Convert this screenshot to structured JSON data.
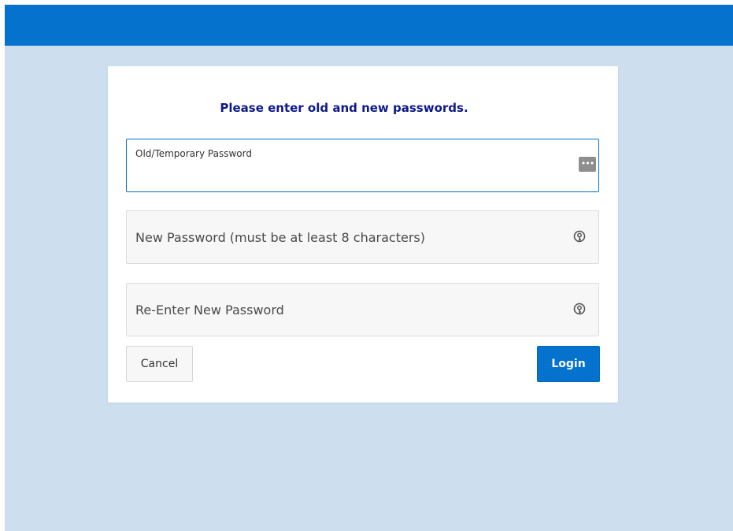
{
  "form": {
    "title": "Please enter old and new passwords.",
    "old_password": {
      "label": "Old/Temporary Password",
      "value": ""
    },
    "new_password": {
      "placeholder": "New Password (must be at least 8 characters)",
      "value": ""
    },
    "confirm_password": {
      "placeholder": "Re-Enter New Password",
      "value": ""
    },
    "cancel_label": "Cancel",
    "login_label": "Login",
    "icons": {
      "old_password": "password-dots-icon",
      "new_password": "key-icon",
      "confirm_password": "key-icon"
    }
  },
  "colors": {
    "header": "#0572ce",
    "page_background": "#cddfee",
    "title": "#0e1a8a",
    "primary_button": "#0572ce"
  }
}
